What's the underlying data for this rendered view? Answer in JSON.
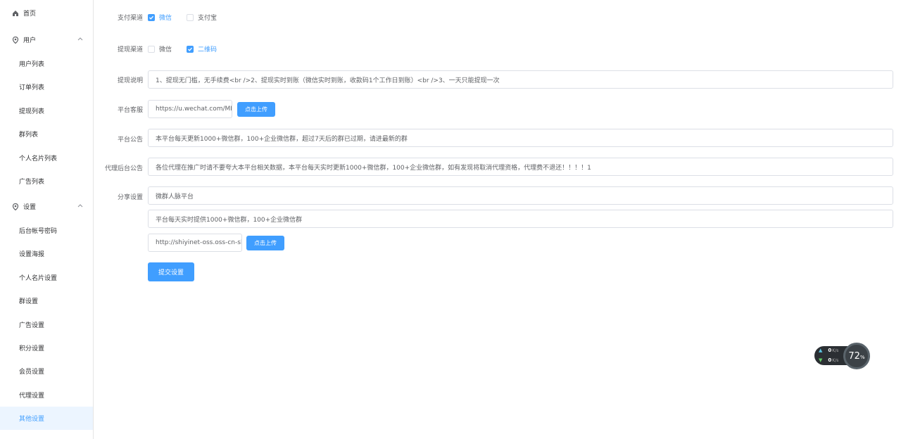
{
  "sidebar": {
    "home": "首页",
    "user_group": "用户",
    "user_items": [
      "用户列表",
      "订单列表",
      "提现列表",
      "群列表",
      "个人名片列表",
      "广告列表"
    ],
    "settings_group": "设置",
    "settings_items": [
      "后台帐号密码",
      "设置海报",
      "个人名片设置",
      "群设置",
      "广告设置",
      "积分设置",
      "会员设置",
      "代理设置",
      "其他设置"
    ],
    "active_item": "其他设置"
  },
  "form": {
    "pay_channel": {
      "label": "支付渠道",
      "options": [
        {
          "label": "微信",
          "checked": true
        },
        {
          "label": "支付宝",
          "checked": false
        }
      ]
    },
    "withdraw_channel": {
      "label": "提现渠道",
      "options": [
        {
          "label": "微信",
          "checked": false
        },
        {
          "label": "二维码",
          "checked": true
        }
      ]
    },
    "withdraw_desc": {
      "label": "提现说明",
      "value": "1、提现无门槛，无手续费<br />2、提现实时到账（微信实时到账，收款码1个工作日到账）<br />3、一天只能提现一次"
    },
    "platform_service": {
      "label": "平台客服",
      "value": "https://u.wechat.com/MI",
      "upload_label": "点击上传"
    },
    "platform_notice": {
      "label": "平台公告",
      "value": "本平台每天更新1000+微信群，100+企业微信群，超过7天后的群已过期，请进最新的群"
    },
    "agent_notice": {
      "label": "代理后台公告",
      "value": "各位代理在推广时请不要夸大本平台相关数据，本平台每天实时更新1000+微信群，100+企业微信群，如有发现将取消代理资格，代理费不退还！！！！1"
    },
    "share": {
      "label": "分享设置",
      "title_value": "微群人脉平台",
      "desc_value": "平台每天实时提供1000+微信群，100+企业微信群",
      "image_value": "http://shiyinet-oss.oss-cn-sl",
      "upload_label": "点击上传"
    },
    "submit_label": "提交设置"
  },
  "widget": {
    "up_speed": "0",
    "down_speed": "0",
    "speed_unit": "K/s",
    "percent": "72",
    "percent_unit": "%"
  },
  "colors": {
    "accent": "#409eff",
    "active_bg": "#ecf5ff",
    "border": "#dcdfe6"
  }
}
